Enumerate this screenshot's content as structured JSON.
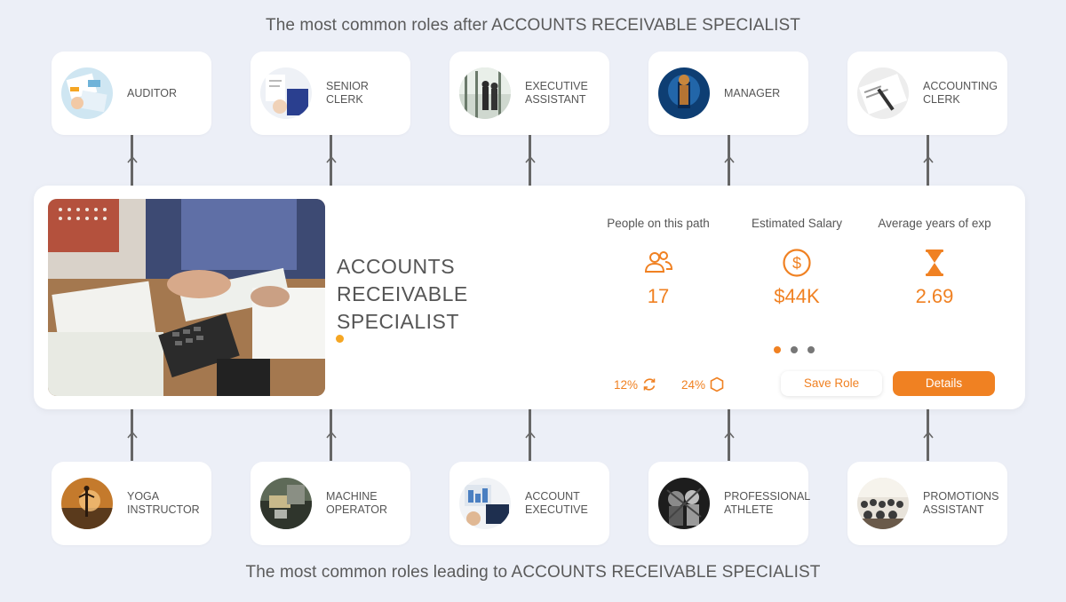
{
  "headings": {
    "top": "The most common roles after ACCOUNTS RECEIVABLE SPECIALIST",
    "bottom": "The most common roles leading to ACCOUNTS RECEIVABLE SPECIALIST"
  },
  "next_roles": [
    {
      "label": "AUDITOR"
    },
    {
      "label": "SENIOR\nCLERK"
    },
    {
      "label": "EXECUTIVE\nASSISTANT"
    },
    {
      "label": "MANAGER"
    },
    {
      "label": "ACCOUNTING\nCLERK"
    }
  ],
  "previous_roles": [
    {
      "label": "YOGA\nINSTRUCTOR"
    },
    {
      "label": "MACHINE\nOPERATOR"
    },
    {
      "label": "ACCOUNT\nEXECUTIVE"
    },
    {
      "label": "PROFESSIONAL\nATHLETE"
    },
    {
      "label": "PROMOTIONS\nASSISTANT"
    }
  ],
  "main": {
    "title": "ACCOUNTS\nRECEIVABLE\nSPECIALIST",
    "stats": {
      "people": {
        "label": "People on this path",
        "value": "17",
        "icon": "people-icon"
      },
      "salary": {
        "label": "Estimated Salary",
        "value": "$44K",
        "icon": "dollar-icon"
      },
      "experience": {
        "label": "Average years of exp",
        "value": "2.69",
        "icon": "hourglass-icon"
      }
    },
    "pager": {
      "count": 3,
      "active": 0
    },
    "metrics": {
      "first": "12%",
      "second": "24%"
    },
    "buttons": {
      "save": "Save Role",
      "details": "Details"
    }
  },
  "colors": {
    "accent": "#f08122",
    "background": "#eceff7",
    "title_dot": "#f5a623"
  }
}
